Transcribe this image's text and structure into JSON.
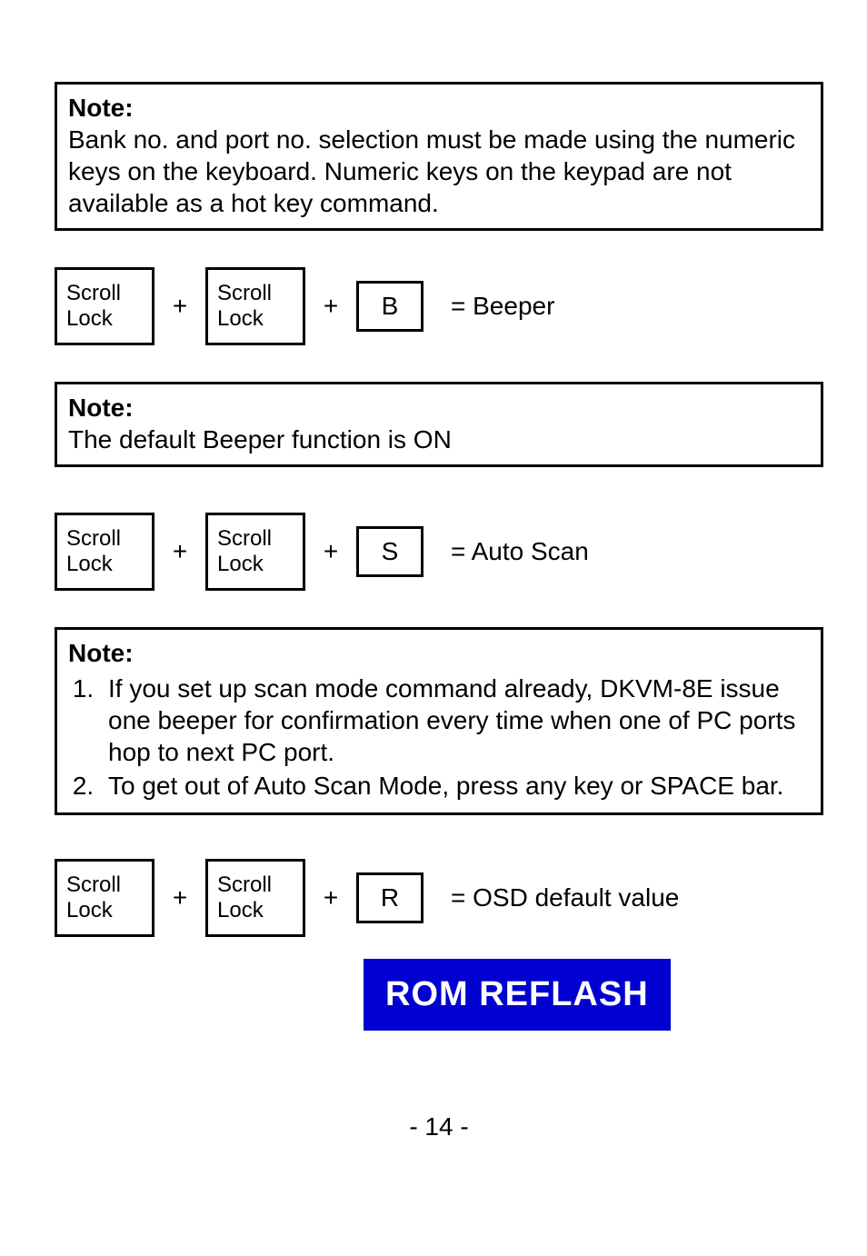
{
  "note1": {
    "title": "Note:",
    "body": "Bank no. and port no. selection must be made using the numeric keys on the keyboard. Numeric keys on the keypad are not available as a hot key command."
  },
  "row_beeper": {
    "key1": "Scroll Lock",
    "plus1": "+",
    "key2": "Scroll Lock",
    "plus2": "+",
    "key3": "B",
    "equals": "= Beeper"
  },
  "note2": {
    "title": "Note:",
    "body": "The default Beeper function is ON"
  },
  "row_autoscan": {
    "key1": "Scroll Lock",
    "plus1": "+",
    "key2": "Scroll Lock",
    "plus2": "+",
    "key3": "S",
    "equals": "= Auto Scan"
  },
  "note3": {
    "title": "Note:",
    "item1": "If you set up scan mode command already, DKVM-8E issue one beeper for confirmation every time when one of PC ports hop to next PC port.",
    "item2": "To get out of Auto Scan Mode, press any key or SPACE bar."
  },
  "row_osd": {
    "key1": "Scroll Lock",
    "plus1": "+",
    "key2": "Scroll Lock",
    "plus2": "+",
    "key3": "R",
    "equals": "= OSD default value"
  },
  "rom_banner": "ROM   REFLASH",
  "page_number": "- 14 -"
}
